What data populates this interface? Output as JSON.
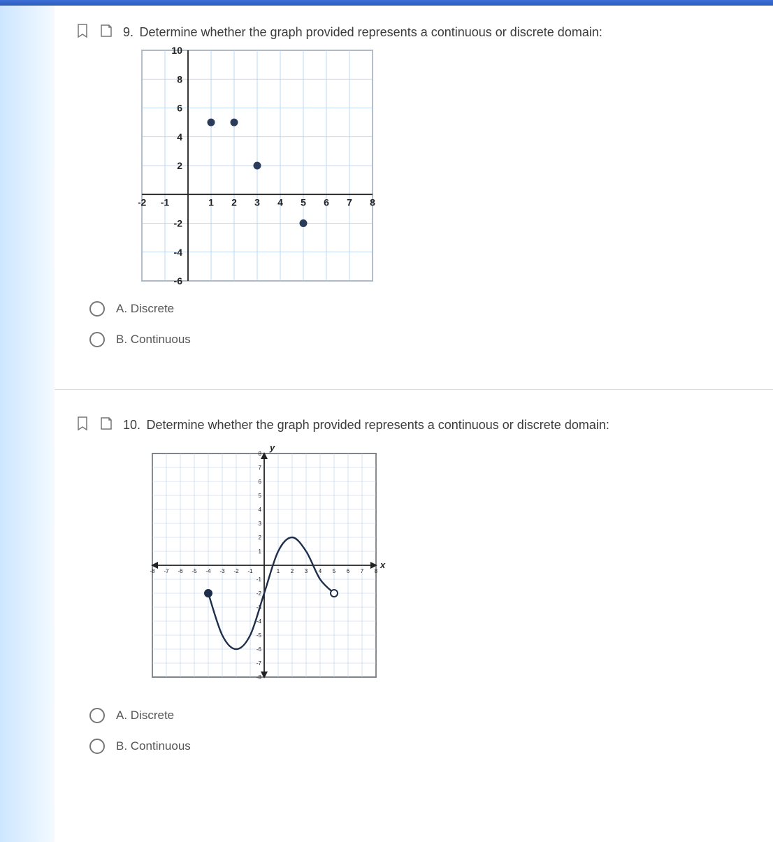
{
  "questions": [
    {
      "number": "9.",
      "prompt": "Determine whether the graph provided represents a continuous or discrete domain:",
      "options": {
        "a": "A. Discrete",
        "b": "B. Continuous"
      },
      "chart_data": {
        "type": "scatter",
        "points": [
          {
            "x": 1,
            "y": 5
          },
          {
            "x": 2,
            "y": 5
          },
          {
            "x": 3,
            "y": 2
          },
          {
            "x": 5,
            "y": -2
          }
        ],
        "x_range": [
          -2,
          8
        ],
        "y_range": [
          -6,
          10
        ],
        "x_ticks": [
          -2,
          -1,
          1,
          2,
          3,
          4,
          5,
          6,
          7,
          8
        ],
        "y_ticks": [
          10,
          8,
          6,
          4,
          2,
          -2,
          -4,
          -6
        ]
      }
    },
    {
      "number": "10.",
      "prompt": "Determine whether the graph provided represents a continuous or discrete domain:",
      "options": {
        "a": "A. Discrete",
        "b": "B. Continuous"
      },
      "chart_data": {
        "type": "line",
        "title": "",
        "xlabel": "x",
        "ylabel": "y",
        "x_range": [
          -8,
          8
        ],
        "y_range": [
          -8,
          8
        ],
        "endpoints": [
          {
            "x": -4,
            "y": -2,
            "closed": true
          },
          {
            "x": 5,
            "y": -2,
            "closed": false
          }
        ],
        "curve_approx": [
          {
            "x": -4,
            "y": -2
          },
          {
            "x": -3,
            "y": -5
          },
          {
            "x": -2,
            "y": -6
          },
          {
            "x": -1,
            "y": -5
          },
          {
            "x": 0,
            "y": -2
          },
          {
            "x": 1,
            "y": 1
          },
          {
            "x": 2,
            "y": 2
          },
          {
            "x": 3,
            "y": 1
          },
          {
            "x": 4,
            "y": -1
          },
          {
            "x": 5,
            "y": -2
          }
        ]
      }
    }
  ]
}
